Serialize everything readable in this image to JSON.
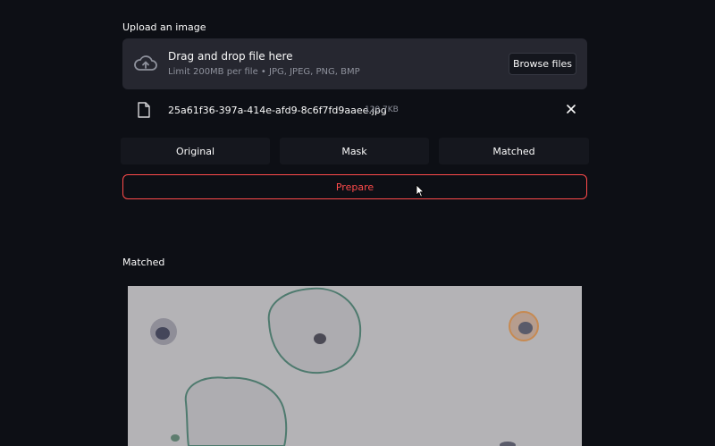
{
  "upload": {
    "label": "Upload an image",
    "dropzone_title": "Drag and drop file here",
    "dropzone_subtitle": "Limit 200MB per file • JPG, JPEG, PNG, BMP",
    "browse_label": "Browse files",
    "cloud_icon": "cloud-upload-icon"
  },
  "file": {
    "name": "25a61f36-397a-414e-afd9-8c6f7fd9aaee.jpg",
    "size": "120.7KB",
    "file_icon": "file-icon",
    "remove_icon": "close-icon"
  },
  "tabs": [
    {
      "label": "Original"
    },
    {
      "label": "Mask"
    },
    {
      "label": "Matched"
    }
  ],
  "actions": {
    "prepare_label": "Prepare"
  },
  "result": {
    "label": "Matched"
  },
  "colors": {
    "background": "#0d0f15",
    "surface": "#262730",
    "accent": "#ff4b4b",
    "muted_text": "#8e919c",
    "image_bg": "#b4b3b6"
  }
}
